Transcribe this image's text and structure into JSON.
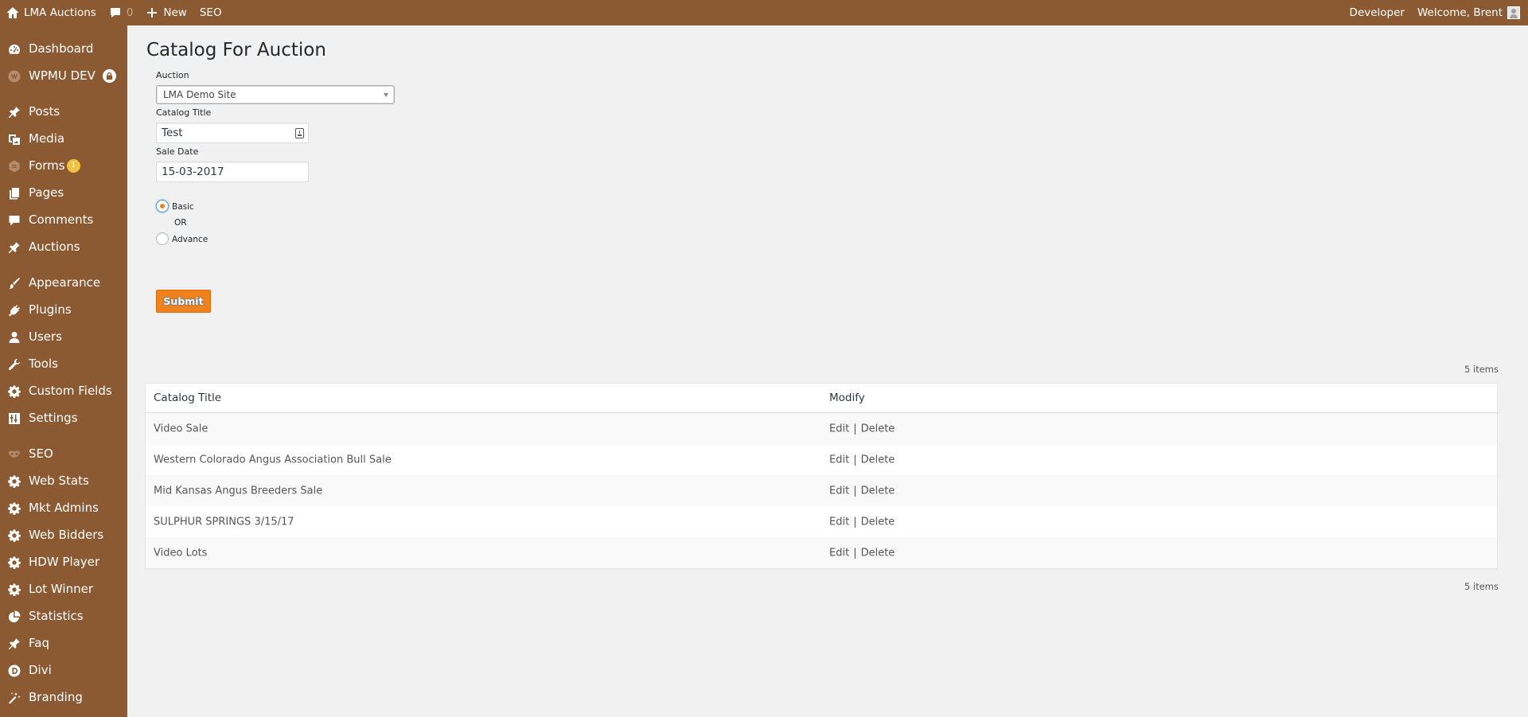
{
  "adminbar": {
    "site_name": "LMA Auctions",
    "comments_count": "0",
    "new_label": "New",
    "seo_label": "SEO",
    "developer_label": "Developer",
    "welcome_label": "Welcome, Brent"
  },
  "sidebar": {
    "items": [
      {
        "label": "Dashboard",
        "icon": "dashboard-icon"
      },
      {
        "label": "WPMU DEV",
        "icon": "wpmudev-icon"
      },
      {
        "label": "Posts",
        "icon": "pin-icon"
      },
      {
        "label": "Media",
        "icon": "media-icon"
      },
      {
        "label": "Forms",
        "icon": "forms-icon",
        "badge": "1"
      },
      {
        "label": "Pages",
        "icon": "pages-icon"
      },
      {
        "label": "Comments",
        "icon": "comments-icon"
      },
      {
        "label": "Auctions",
        "icon": "pin-icon"
      },
      {
        "label": "Appearance",
        "icon": "brush-icon"
      },
      {
        "label": "Plugins",
        "icon": "plugin-icon"
      },
      {
        "label": "Users",
        "icon": "user-icon"
      },
      {
        "label": "Tools",
        "icon": "wrench-icon"
      },
      {
        "label": "Custom Fields",
        "icon": "gear-icon"
      },
      {
        "label": "Settings",
        "icon": "settings-icon"
      },
      {
        "label": "SEO",
        "icon": "seo-icon"
      },
      {
        "label": "Web Stats",
        "icon": "gear-icon"
      },
      {
        "label": "Mkt Admins",
        "icon": "gear-icon"
      },
      {
        "label": "Web Bidders",
        "icon": "gear-icon"
      },
      {
        "label": "HDW Player",
        "icon": "gear-icon"
      },
      {
        "label": "Lot Winner",
        "icon": "gear-icon"
      },
      {
        "label": "Statistics",
        "icon": "pie-chart-icon"
      },
      {
        "label": "Faq",
        "icon": "pin-icon"
      },
      {
        "label": "Divi",
        "icon": "divi-icon"
      },
      {
        "label": "Branding",
        "icon": "magic-wand-icon"
      }
    ]
  },
  "main": {
    "title": "Catalog For Auction",
    "auction_label": "Auction",
    "auction_value": "LMA Demo Site",
    "catalog_title_label": "Catalog Title",
    "catalog_title_value": "Test",
    "sale_date_label": "Sale Date",
    "sale_date_value": "15-03-2017",
    "radio_basic": "Basic",
    "radio_or": "OR",
    "radio_advance": "Advance",
    "submit_label": "Submit",
    "items_count": "5 items"
  },
  "table": {
    "headers": [
      "Catalog Title",
      "Modify"
    ],
    "edit_label": "Edit",
    "separator": "|",
    "delete_label": "Delete",
    "rows": [
      "Video Sale",
      "Western Colorado Angus Association Bull Sale",
      "Mid Kansas Angus Breeders Sale",
      "SULPHUR SPRINGS 3/15/17",
      "Video Lots"
    ]
  }
}
